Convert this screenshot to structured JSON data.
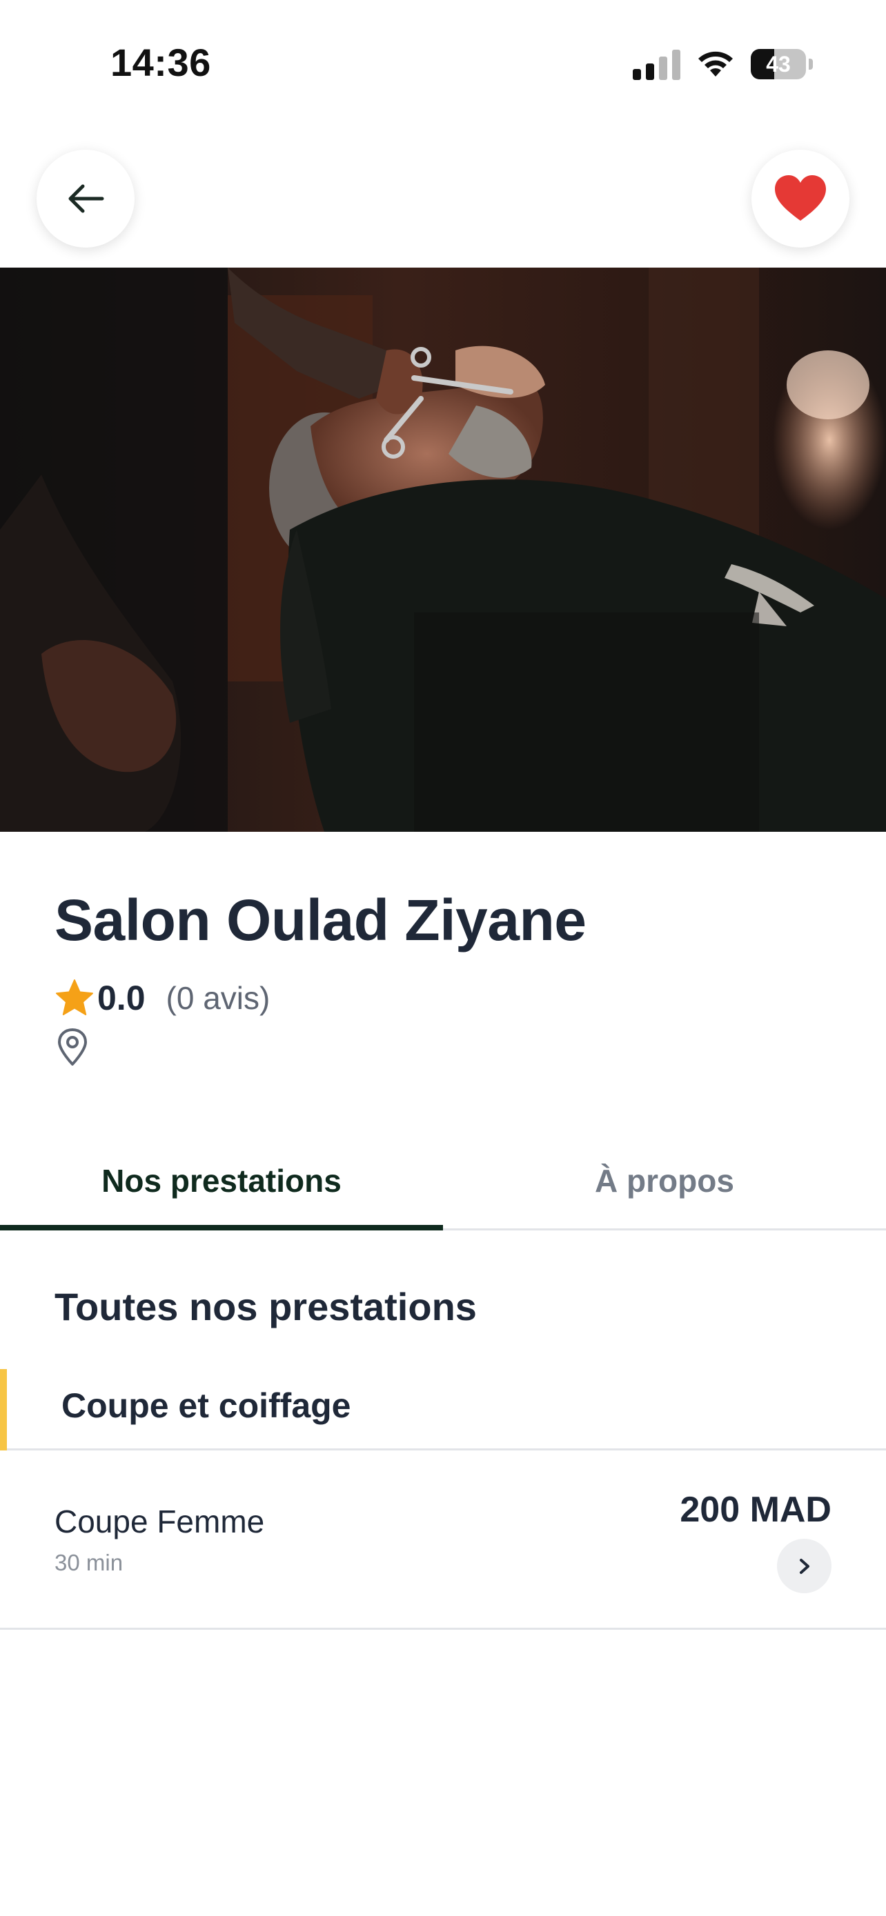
{
  "status_bar": {
    "time": "14:36",
    "battery_level": "43",
    "battery_fraction": 0.43,
    "signal_bars_active": 2,
    "signal_bars_total": 4
  },
  "header": {
    "back_icon": "arrow-left-icon",
    "favorite_icon": "heart-icon",
    "favorite_color": "#e53935"
  },
  "hero": {
    "image": "barber-trimming-beard-photo"
  },
  "salon": {
    "name": "Salon Oulad Ziyane",
    "rating": "0.0",
    "review_count": "(0 avis)",
    "star_color": "#f5a117",
    "location_icon": "map-pin-icon"
  },
  "tabs": [
    {
      "label": "Nos prestations",
      "active": true
    },
    {
      "label": "À propos",
      "active": false
    }
  ],
  "services_section": {
    "title": "Toutes nos prestations",
    "categories": [
      {
        "label": "Coupe et coiffage",
        "accent_color": "#f7c544",
        "services": [
          {
            "name": "Coupe Femme",
            "duration": "30 min",
            "price": "200 MAD"
          }
        ]
      }
    ]
  },
  "colors": {
    "primary_dark": "#0f2a1e",
    "text": "#1f2838",
    "muted": "#737b87"
  }
}
